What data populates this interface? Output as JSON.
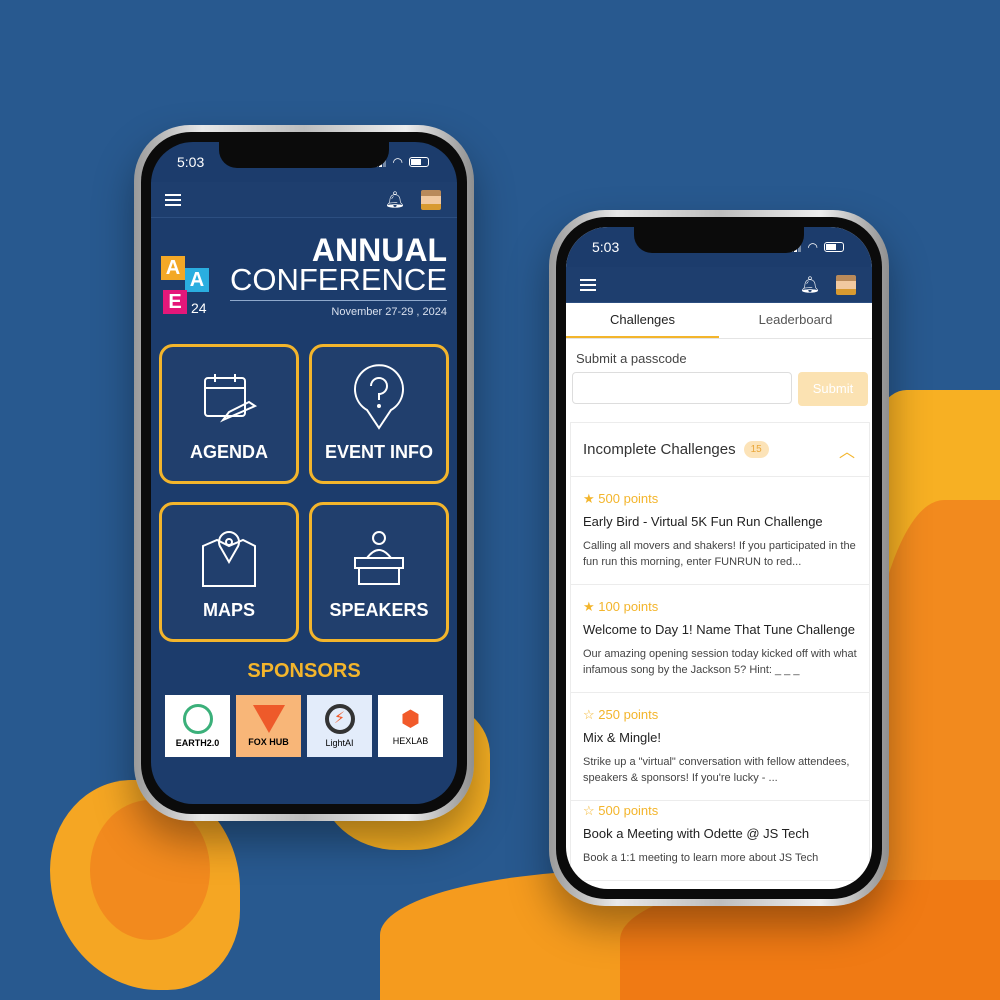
{
  "colors": {
    "background": "#28598f",
    "accent": "#f3b52c",
    "navy": "#1c3c6c"
  },
  "left_phone": {
    "status": {
      "time": "5:03"
    },
    "topbar": {
      "menu_icon": "hamburger-icon",
      "bell_icon": "bell-icon"
    },
    "brand": {
      "logo_letters": [
        "A",
        "A",
        "E"
      ],
      "logo_year": "24",
      "title_line1": "ANNUAL",
      "title_line2": "CONFERENCE",
      "date": "November 27-29 , 2024"
    },
    "tiles": [
      {
        "label": "AGENDA",
        "icon": "calendar-plane-icon"
      },
      {
        "label": "EVENT INFO",
        "icon": "question-pin-icon"
      },
      {
        "label": "MAPS",
        "icon": "map-pin-icon"
      },
      {
        "label": "SPEAKERS",
        "icon": "speaker-podium-icon"
      }
    ],
    "sponsors_title": "SPONSORS",
    "sponsors": [
      {
        "name": "EARTH2.0"
      },
      {
        "name": "FOX HUB"
      },
      {
        "name": "LightAI"
      },
      {
        "name": "HEXLAB"
      }
    ]
  },
  "right_phone": {
    "status": {
      "time": "5:03"
    },
    "tabs": [
      {
        "label": "Challenges",
        "active": true
      },
      {
        "label": "Leaderboard",
        "active": false
      }
    ],
    "passcode": {
      "label": "Submit a passcode",
      "value": "",
      "placeholder": "",
      "submit_label": "Submit"
    },
    "section": {
      "title": "Incomplete Challenges",
      "count": "15",
      "expanded": true
    },
    "challenges": [
      {
        "points": "500 points",
        "starred": true,
        "name": "Early Bird - Virtual 5K Fun Run Challenge",
        "desc": "Calling all movers and shakers! If you participated in the fun run this morning, enter FUNRUN to red..."
      },
      {
        "points": "100 points",
        "starred": true,
        "name": "Welcome to Day 1! Name That Tune Challenge",
        "desc": "Our amazing opening session today kicked off with what infamous song by the Jackson 5? Hint: _ _ _"
      },
      {
        "points": "250 points",
        "starred": false,
        "name": "Mix & Mingle!",
        "desc": "Strike up a \"virtual\" conversation with fellow attendees, speakers & sponsors! If you're lucky - ..."
      },
      {
        "points": "500 points",
        "starred": false,
        "name": "Book a Meeting with Odette @ JS Tech",
        "desc": "Book a 1:1 meeting to learn more about JS Tech"
      }
    ]
  }
}
